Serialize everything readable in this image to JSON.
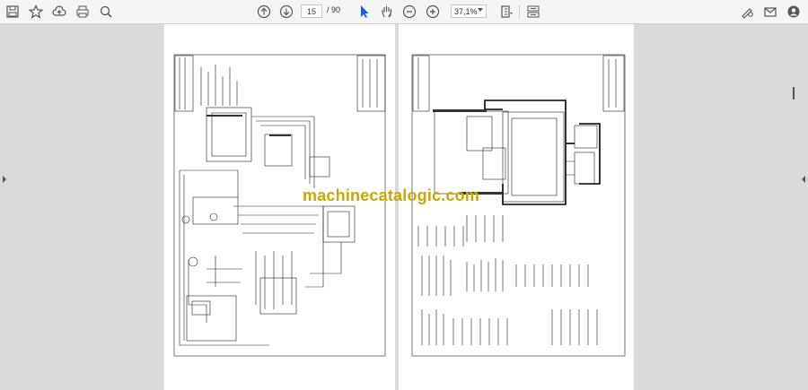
{
  "toolbar": {
    "current_page": "15",
    "page_separator": "/",
    "total_pages": "90",
    "zoom_level": "37,1%"
  },
  "watermark": "machinecatalogic.com",
  "colors": {
    "watermark": "#c9a800",
    "toolbar_bg": "#f5f5f5",
    "viewer_bg": "#dadada",
    "cursor_blue": "#1a5fd4"
  }
}
